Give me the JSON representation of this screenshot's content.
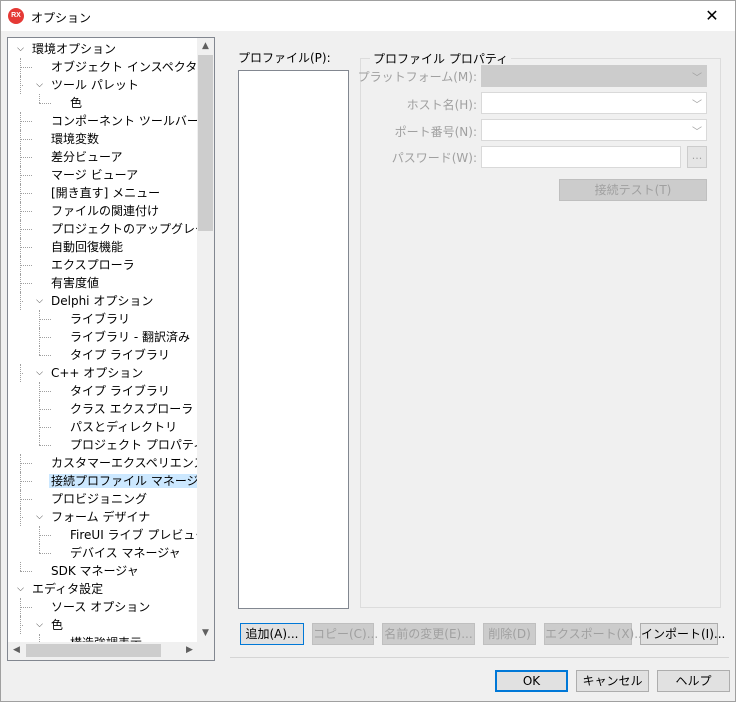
{
  "window": {
    "title": "オプション",
    "app_icon_text": "RX",
    "close_glyph": "✕"
  },
  "tree": {
    "items": [
      {
        "label": "環境オプション"
      },
      {
        "label": "オブジェクト インスペクタ"
      },
      {
        "label": "ツール パレット"
      },
      {
        "label": "色"
      },
      {
        "label": "コンポーネント ツールバー"
      },
      {
        "label": "環境変数"
      },
      {
        "label": "差分ビューア"
      },
      {
        "label": "マージ ビューア"
      },
      {
        "label": "[開き直す] メニュー"
      },
      {
        "label": "ファイルの関連付け"
      },
      {
        "label": "プロジェクトのアップグレード"
      },
      {
        "label": "自動回復機能"
      },
      {
        "label": "エクスプローラ"
      },
      {
        "label": "有害度値"
      },
      {
        "label": "Delphi オプション"
      },
      {
        "label": "ライブラリ"
      },
      {
        "label": "ライブラリ - 翻訳済み"
      },
      {
        "label": "タイプ ライブラリ"
      },
      {
        "label": "C++ オプション"
      },
      {
        "label": "タイプ ライブラリ"
      },
      {
        "label": "クラス エクスプローラ"
      },
      {
        "label": "パスとディレクトリ"
      },
      {
        "label": "プロジェクト プロパティ"
      },
      {
        "label": "カスタマーエクスペリエンス プログ"
      },
      {
        "label": "接続プロファイル マネージャ"
      },
      {
        "label": "プロビジョニング"
      },
      {
        "label": "フォーム デザイナ"
      },
      {
        "label": "FireUI ライブ プレビュー"
      },
      {
        "label": "デバイス マネージャ"
      },
      {
        "label": "SDK マネージャ"
      },
      {
        "label": "エディタ設定"
      },
      {
        "label": "ソース オプション"
      },
      {
        "label": "色"
      },
      {
        "label": "構造強調表示"
      }
    ],
    "selected_index": 24
  },
  "profiles": {
    "label": "プロファイル(P):"
  },
  "properties": {
    "group_title": "プロファイル プロパティ",
    "platform_label": "プラットフォーム(M):",
    "host_label": "ホスト名(H):",
    "port_label": "ポート番号(N):",
    "password_label": "パスワード(W):",
    "ellipsis": "...",
    "test_button": "接続テスト(T)"
  },
  "actions": {
    "add": "追加(A)...",
    "copy": "コピー(C)...",
    "rename": "名前の変更(E)...",
    "delete": "削除(D)",
    "export": "エクスポート(X)...",
    "import": "インポート(I)..."
  },
  "footer": {
    "ok": "OK",
    "cancel": "キャンセル",
    "help": "ヘルプ"
  },
  "colors": {
    "selection": "#cce8ff",
    "focus_border": "#0078d7",
    "dialog_bg": "#f0f0f0"
  },
  "icons": {
    "expanded": "chevron-down-icon",
    "scroll_up": "arrow-up-icon",
    "scroll_down": "arrow-down-icon",
    "scroll_left": "arrow-left-icon",
    "scroll_right": "arrow-right-icon",
    "dropdown": "chevron-down-icon"
  }
}
